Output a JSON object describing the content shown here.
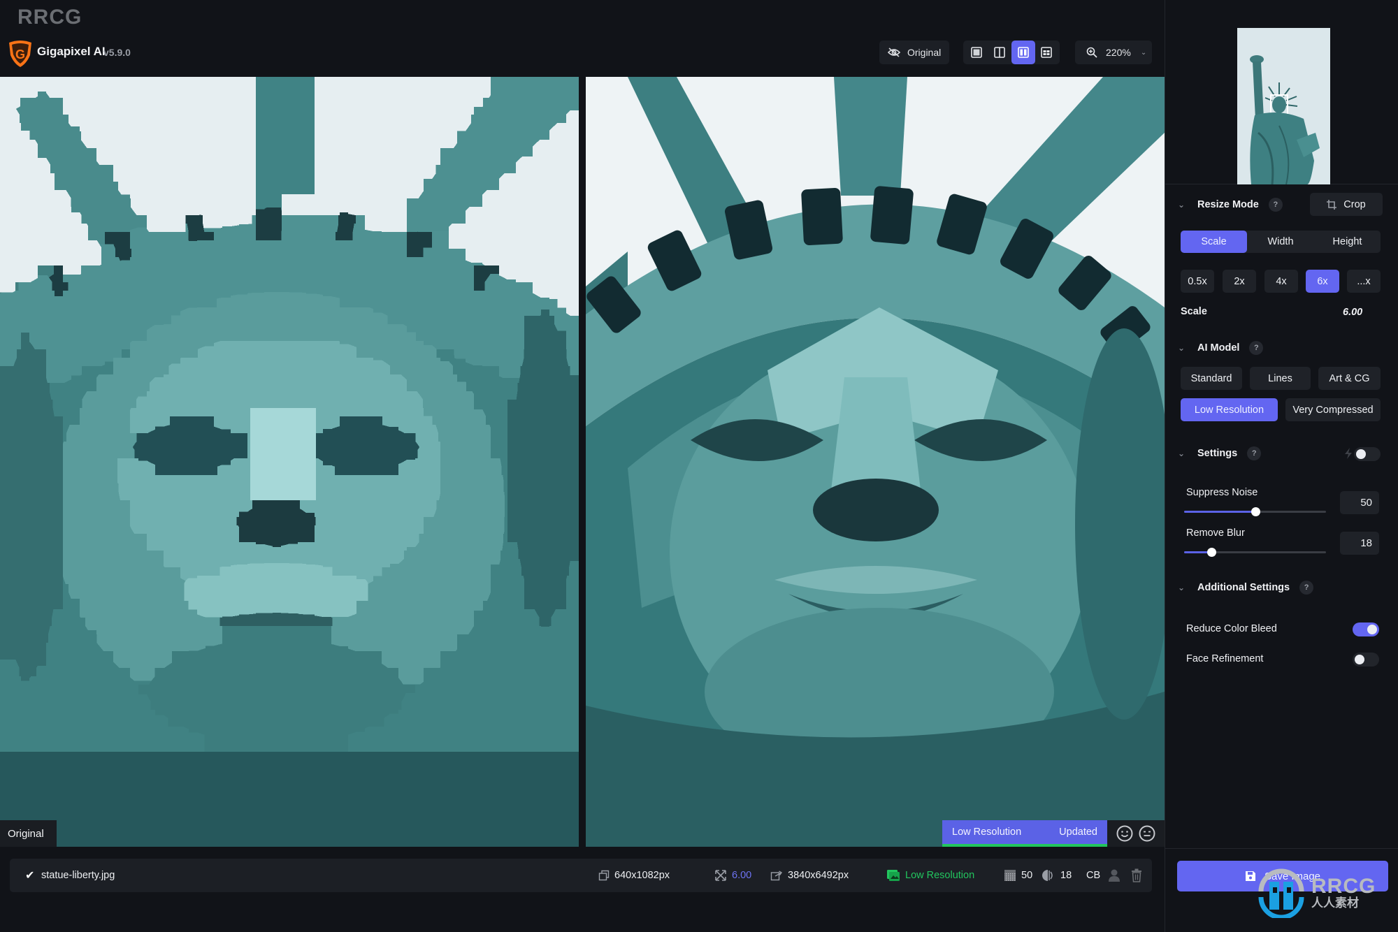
{
  "watermark": {
    "top_text": "RRCG",
    "logo_main": "RRCG",
    "logo_sub": "人人素材"
  },
  "app": {
    "title": "Gigapixel AI",
    "version": "v5.9.0"
  },
  "toolbar": {
    "original_label": "Original",
    "original_icon": "eye-slash-icon",
    "views": [
      {
        "name": "single-view",
        "icon": "single-view-icon",
        "active": false
      },
      {
        "name": "split-view",
        "icon": "split-view-icon",
        "active": false
      },
      {
        "name": "side-by-side-view",
        "icon": "side-by-side-icon",
        "active": true
      },
      {
        "name": "grid-view",
        "icon": "grid-view-icon",
        "active": false
      }
    ],
    "zoom_value": "220%",
    "zoom_icon": "zoom-in-icon"
  },
  "preview": {
    "left_label": "Original",
    "status_model": "Low Resolution",
    "status_state": "Updated",
    "feedback": [
      "smile-face-icon",
      "neutral-face-icon"
    ]
  },
  "file": {
    "checked": true,
    "name": "statue-liberty.jpg",
    "input_size": "640x1082px",
    "scale": "6.00",
    "output_size": "3840x6492px",
    "model": "Low Resolution",
    "noise": "50",
    "blur": "18",
    "color_bleed_badge": "CB"
  },
  "sidebar": {
    "resize_mode": {
      "title": "Resize Mode",
      "help": "?",
      "crop_label": "Crop",
      "modes": [
        {
          "label": "Scale",
          "active": true
        },
        {
          "label": "Width",
          "active": false
        },
        {
          "label": "Height",
          "active": false
        }
      ],
      "presets": [
        {
          "label": "0.5x",
          "active": false
        },
        {
          "label": "2x",
          "active": false
        },
        {
          "label": "4x",
          "active": false
        },
        {
          "label": "6x",
          "active": true
        },
        {
          "label": "...x",
          "active": false
        }
      ],
      "scale_label": "Scale",
      "scale_value": "6.00"
    },
    "ai_model": {
      "title": "AI Model",
      "help": "?",
      "models": [
        {
          "label": "Standard",
          "active": false
        },
        {
          "label": "Lines",
          "active": false
        },
        {
          "label": "Art & CG",
          "active": false
        },
        {
          "label": "Low Resolution",
          "active": true
        },
        {
          "label": "Very Compressed",
          "active": false
        }
      ]
    },
    "settings": {
      "title": "Settings",
      "help": "?",
      "auto_toggle_on": false,
      "suppress_noise_label": "Suppress Noise",
      "suppress_noise_value": "50",
      "suppress_noise_fraction": 0.5,
      "remove_blur_label": "Remove Blur",
      "remove_blur_value": "18",
      "remove_blur_fraction": 0.19
    },
    "additional": {
      "title": "Additional Settings",
      "help": "?",
      "reduce_color_bleed_label": "Reduce Color Bleed",
      "reduce_color_bleed_on": true,
      "face_refinement_label": "Face Refinement",
      "face_refinement_on": false
    },
    "save_label": "Save Image"
  },
  "colors": {
    "accent": "#6366f1",
    "success": "#22c55e",
    "background": "#111318",
    "surface": "#1f2228"
  }
}
